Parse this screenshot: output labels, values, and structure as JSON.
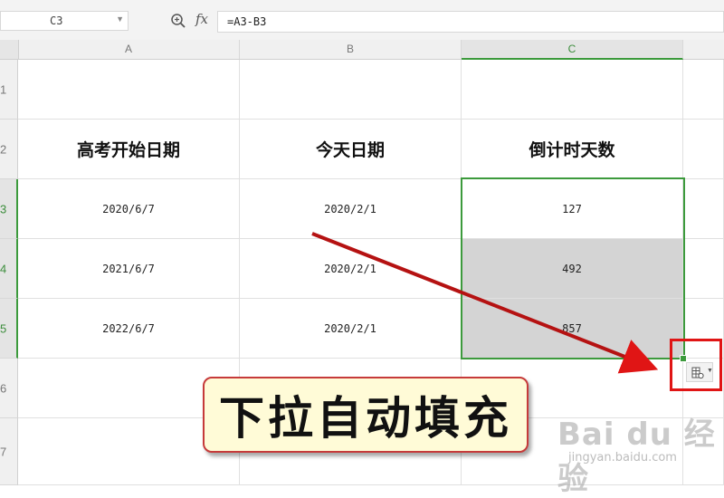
{
  "formula_bar": {
    "name_box": "C3",
    "fx_label": "fx",
    "formula": "=A3-B3"
  },
  "columns": [
    "A",
    "B",
    "C"
  ],
  "rows": [
    "1",
    "2",
    "3",
    "4",
    "5",
    "6",
    "7"
  ],
  "table": {
    "headers": [
      "高考开始日期",
      "今天日期",
      "倒计时天数"
    ],
    "rows": [
      [
        "2020/6/7",
        "2020/2/1",
        "127"
      ],
      [
        "2021/6/7",
        "2020/2/1",
        "492"
      ],
      [
        "2022/6/7",
        "2020/2/1",
        "857"
      ]
    ]
  },
  "callout": {
    "text": "下拉自动填充"
  },
  "watermark": {
    "logo": "Bai du 经验",
    "sub": "jingyan.baidu.com"
  },
  "colors": {
    "selection": "#3c9a3c",
    "annotation": "#e01515",
    "callout_bg": "#fffbd7"
  }
}
